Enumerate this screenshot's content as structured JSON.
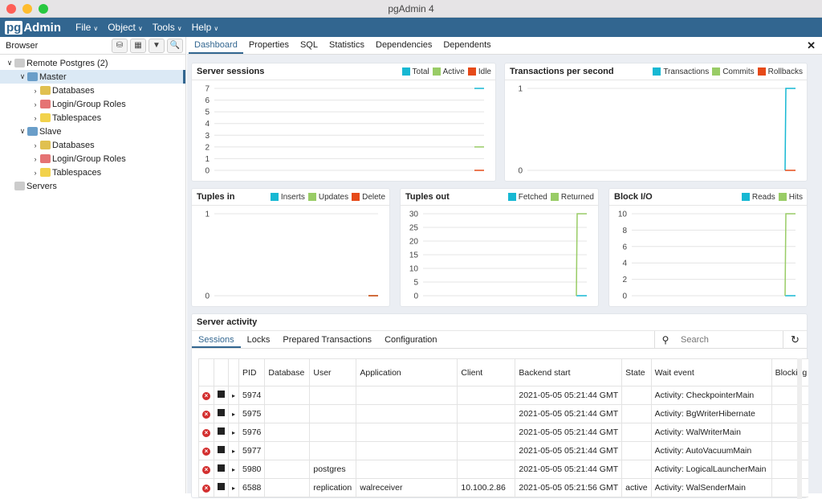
{
  "window": {
    "title": "pgAdmin 4"
  },
  "menubar": {
    "logo_pg": "pg",
    "logo_admin": "Admin",
    "menus": [
      "File",
      "Object",
      "Tools",
      "Help"
    ]
  },
  "browser": {
    "title": "Browser",
    "tree": [
      {
        "label": "Remote Postgres (2)",
        "level": 0,
        "expand": "v",
        "icon": "server-group-icon"
      },
      {
        "label": "Master",
        "level": 1,
        "expand": "v",
        "icon": "elephant-icon",
        "selected": true
      },
      {
        "label": "Databases",
        "level": 2,
        "expand": ">",
        "icon": "databases-icon"
      },
      {
        "label": "Login/Group Roles",
        "level": 2,
        "expand": ">",
        "icon": "roles-icon"
      },
      {
        "label": "Tablespaces",
        "level": 2,
        "expand": ">",
        "icon": "tablespaces-icon"
      },
      {
        "label": "Slave",
        "level": 1,
        "expand": "v",
        "icon": "elephant-icon"
      },
      {
        "label": "Databases",
        "level": 2,
        "expand": ">",
        "icon": "databases-icon"
      },
      {
        "label": "Login/Group Roles",
        "level": 2,
        "expand": ">",
        "icon": "roles-icon"
      },
      {
        "label": "Tablespaces",
        "level": 2,
        "expand": ">",
        "icon": "tablespaces-icon"
      },
      {
        "label": "Servers",
        "level": 0,
        "expand": "",
        "icon": "server-group-icon"
      }
    ]
  },
  "tabs": [
    "Dashboard",
    "Properties",
    "SQL",
    "Statistics",
    "Dependencies",
    "Dependents"
  ],
  "colors": {
    "c1": "#17b8d3",
    "c2": "#99cc66",
    "c3": "#e64a19"
  },
  "chart_data": [
    {
      "type": "line",
      "title": "Server sessions",
      "ylim": [
        0,
        7
      ],
      "yticks": [
        "0",
        "1",
        "2",
        "3",
        "4",
        "5",
        "6",
        "7"
      ],
      "series": [
        {
          "name": "Total",
          "values": [
            7,
            7
          ]
        },
        {
          "name": "Active",
          "values": [
            2,
            2
          ]
        },
        {
          "name": "Idle",
          "values": [
            0,
            0
          ]
        }
      ]
    },
    {
      "type": "line",
      "title": "Transactions per second",
      "ylim": [
        0,
        1
      ],
      "yticks": [
        "0",
        "1"
      ],
      "series": [
        {
          "name": "Transactions",
          "values": [
            0,
            1,
            1
          ]
        },
        {
          "name": "Commits",
          "values": [
            null,
            null,
            null
          ]
        },
        {
          "name": "Rollbacks",
          "values": [
            0,
            0,
            0
          ]
        }
      ]
    },
    {
      "type": "line",
      "title": "Tuples in",
      "ylim": [
        0,
        1
      ],
      "yticks": [
        "0",
        "1"
      ],
      "series": [
        {
          "name": "Inserts",
          "values": [
            0,
            0
          ]
        },
        {
          "name": "Updates",
          "values": [
            0,
            0
          ]
        },
        {
          "name": "Delete",
          "values": [
            0,
            0
          ]
        }
      ]
    },
    {
      "type": "line",
      "title": "Tuples out",
      "ylim": [
        0,
        30
      ],
      "yticks": [
        "0",
        "5",
        "10",
        "15",
        "20",
        "25",
        "30"
      ],
      "series": [
        {
          "name": "Fetched",
          "values": [
            0,
            0,
            0
          ]
        },
        {
          "name": "Returned",
          "values": [
            0,
            30,
            30
          ]
        }
      ]
    },
    {
      "type": "line",
      "title": "Block I/O",
      "ylim": [
        0,
        10
      ],
      "yticks": [
        "0",
        "2",
        "4",
        "6",
        "8",
        "10"
      ],
      "series": [
        {
          "name": "Reads",
          "values": [
            0,
            0,
            0
          ]
        },
        {
          "name": "Hits",
          "values": [
            0,
            10,
            10
          ]
        }
      ]
    }
  ],
  "activity": {
    "title": "Server activity",
    "tabs": [
      "Sessions",
      "Locks",
      "Prepared Transactions",
      "Configuration"
    ],
    "search_placeholder": "Search",
    "columns": [
      "",
      "",
      "",
      "PID",
      "Database",
      "User",
      "Application",
      "Client",
      "Backend start",
      "State",
      "Wait event",
      "Blocking P"
    ],
    "rows": [
      [
        "5974",
        "",
        "",
        "",
        "",
        "2021-05-05 05:21:44 GMT",
        "",
        "Activity: CheckpointerMain",
        ""
      ],
      [
        "5975",
        "",
        "",
        "",
        "",
        "2021-05-05 05:21:44 GMT",
        "",
        "Activity: BgWriterHibernate",
        ""
      ],
      [
        "5976",
        "",
        "",
        "",
        "",
        "2021-05-05 05:21:44 GMT",
        "",
        "Activity: WalWriterMain",
        ""
      ],
      [
        "5977",
        "",
        "",
        "",
        "",
        "2021-05-05 05:21:44 GMT",
        "",
        "Activity: AutoVacuumMain",
        ""
      ],
      [
        "5980",
        "",
        "postgres",
        "",
        "",
        "2021-05-05 05:21:44 GMT",
        "",
        "Activity: LogicalLauncherMain",
        ""
      ],
      [
        "6588",
        "",
        "replication",
        "walreceiver",
        "10.100.2.86",
        "2021-05-05 05:21:56 GMT",
        "active",
        "Activity: WalSenderMain",
        ""
      ]
    ]
  }
}
